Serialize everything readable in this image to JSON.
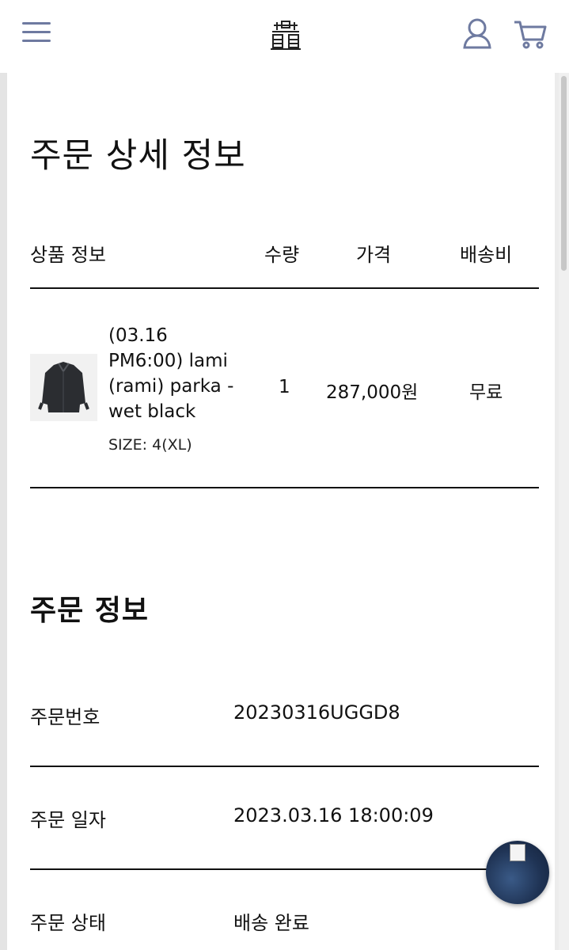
{
  "header": {
    "menu_icon": "hamburger-icon",
    "logo_icon": "brand-logo",
    "user_icon": "user-icon",
    "cart_icon": "cart-icon"
  },
  "page_title": "주문 상세 정보",
  "table": {
    "headers": {
      "product": "상품 정보",
      "qty": "수량",
      "price": "가격",
      "shipping": "배송비"
    },
    "rows": [
      {
        "name_lines": [
          "(03.16",
          "PM6:00) lami",
          "(rami) parka -",
          "wet black"
        ],
        "size": "SIZE: 4(XL)",
        "qty": "1",
        "price": "287,000원",
        "shipping": "무료"
      }
    ]
  },
  "order_info": {
    "title": "주문 정보",
    "fields": [
      {
        "label": "주문번호",
        "value": "20230316UGGD8"
      },
      {
        "label": "주문 일자",
        "value": "2023.03.16 18:00:09"
      },
      {
        "label": "주문 상태",
        "value": "배송 완료"
      }
    ]
  },
  "chat_button_icon": "chat-icon",
  "colors": {
    "icon_accent": "#6e7aa0",
    "text": "#111111",
    "divider": "#111111"
  }
}
